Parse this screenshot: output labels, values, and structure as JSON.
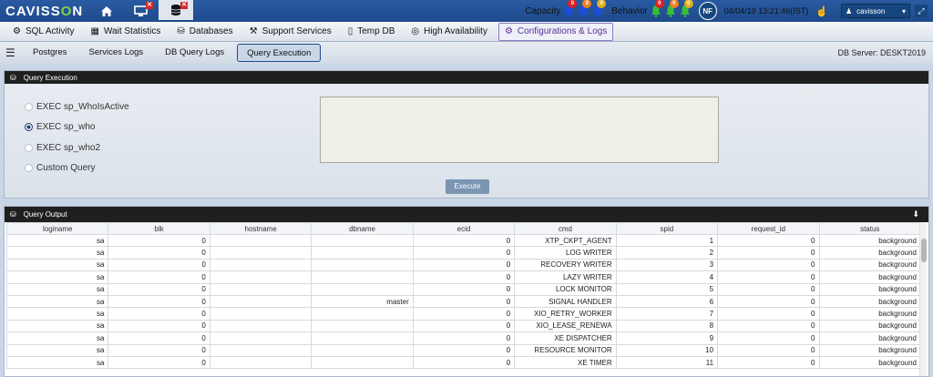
{
  "logo": {
    "pre": "CAVISS",
    "o": "O",
    "post": "N"
  },
  "top": {
    "capacity_label": "Capacity",
    "behavior_label": "Behavior",
    "capacity_counts": [
      "0",
      "0",
      "0"
    ],
    "behavior_counts": [
      "0",
      "0",
      "0"
    ],
    "user_initials": "NF",
    "datetime": "04/04/19 13:21:46(IST)",
    "username": "cavisson"
  },
  "nav": [
    {
      "label": "SQL Activity",
      "icon": "sql-activity-icon"
    },
    {
      "label": "Wait Statistics",
      "icon": "wait-statistics-icon"
    },
    {
      "label": "Databases",
      "icon": "database-icon"
    },
    {
      "label": "Support Services",
      "icon": "support-services-icon"
    },
    {
      "label": "Temp DB",
      "icon": "temp-db-icon"
    },
    {
      "label": "High Availability",
      "icon": "high-availability-icon"
    },
    {
      "label": "Configurations & Logs",
      "icon": "gear-icon"
    }
  ],
  "subnav": {
    "tabs": [
      "Postgres",
      "Services Logs",
      "DB Query Logs",
      "Query Execution"
    ],
    "db_server": "DB Server: DESKT2019"
  },
  "query_execution": {
    "title": "Query Execution",
    "options": [
      "EXEC sp_WhoIsActive",
      "EXEC sp_who",
      "EXEC sp_who2",
      "Custom Query"
    ],
    "selected_index": 1,
    "query_text": "",
    "execute_label": "Execute"
  },
  "query_output": {
    "title": "Query Output",
    "columns": [
      "loginame",
      "blk",
      "hostname",
      "dbname",
      "ecid",
      "cmd",
      "spid",
      "request_id",
      "status"
    ],
    "rows": [
      [
        "sa",
        "0",
        "",
        "",
        "0",
        "XTP_CKPT_AGENT",
        "1",
        "0",
        "background"
      ],
      [
        "sa",
        "0",
        "",
        "",
        "0",
        "LOG WRITER",
        "2",
        "0",
        "background"
      ],
      [
        "sa",
        "0",
        "",
        "",
        "0",
        "RECOVERY WRITER",
        "3",
        "0",
        "background"
      ],
      [
        "sa",
        "0",
        "",
        "",
        "0",
        "LAZY WRITER",
        "4",
        "0",
        "background"
      ],
      [
        "sa",
        "0",
        "",
        "",
        "0",
        "LOCK MONITOR",
        "5",
        "0",
        "background"
      ],
      [
        "sa",
        "0",
        "",
        "master",
        "0",
        "SIGNAL HANDLER",
        "6",
        "0",
        "background"
      ],
      [
        "sa",
        "0",
        "",
        "",
        "0",
        "XIO_RETRY_WORKER",
        "7",
        "0",
        "background"
      ],
      [
        "sa",
        "0",
        "",
        "",
        "0",
        "XIO_LEASE_RENEWA",
        "8",
        "0",
        "background"
      ],
      [
        "sa",
        "0",
        "",
        "",
        "0",
        "XE DISPATCHER",
        "9",
        "0",
        "background"
      ],
      [
        "sa",
        "0",
        "",
        "",
        "0",
        "RESOURCE MONITOR",
        "10",
        "0",
        "background"
      ],
      [
        "sa",
        "0",
        "",
        "",
        "0",
        "XE TIMER",
        "11",
        "0",
        "background"
      ]
    ]
  }
}
